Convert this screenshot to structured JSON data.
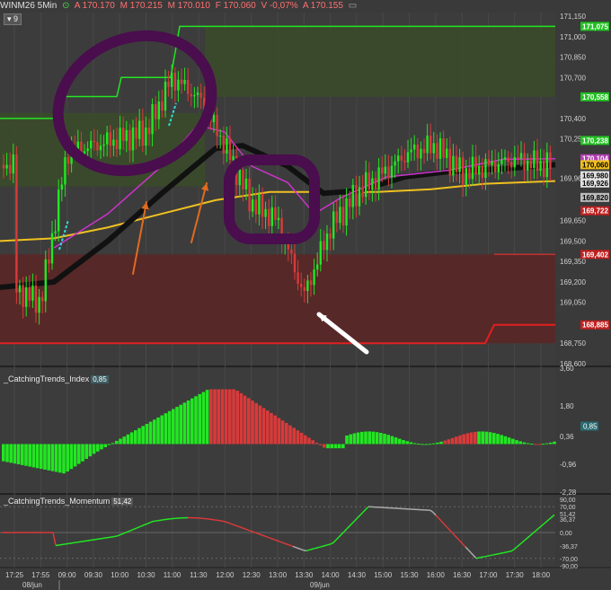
{
  "header": {
    "symbol": "WINM26 5Min",
    "open": "A 170.170",
    "high": "M 170.215",
    "low": "M 170.010",
    "close": "F 170.060",
    "change": "V -0,07%",
    "avg": "A 170.155",
    "layer_count": "9"
  },
  "colors": {
    "bg": "#3a3a3a",
    "up": "#22e622",
    "down": "#d83a3a",
    "annot_purple": "#4a0d4d",
    "orange_arrow": "#e06b20",
    "cyan": "#33dddd",
    "yellow": "#f0c020"
  },
  "main_chart": {
    "y_ticks": [
      "171,150",
      "171,000",
      "170,850",
      "170,700",
      "170,400",
      "170,250",
      "169,960",
      "169,650",
      "169,500",
      "169,350",
      "169,200",
      "169,050",
      "168,750",
      "168,600"
    ],
    "price_labels": [
      {
        "text": "171,075",
        "color": "#22c022"
      },
      {
        "text": "170,558",
        "color": "#22c022"
      },
      {
        "text": "170,238",
        "color": "#22c022"
      },
      {
        "text": "170,104",
        "color": "#b040b0"
      },
      {
        "text": "170,060",
        "color": "#f0c020"
      },
      {
        "text": "169,980",
        "color": "#222222"
      },
      {
        "text": "169,926",
        "color": "#222222"
      },
      {
        "text": "169,820",
        "color": "#333333"
      },
      {
        "text": "169,722",
        "color": "#c02020"
      },
      {
        "text": "169,402",
        "color": "#c02020"
      },
      {
        "text": "168,885",
        "color": "#c02020"
      }
    ]
  },
  "index_panel": {
    "label": "_CatchingTrends_Index",
    "value": "0,85",
    "y_ticks": [
      "3,60",
      "1,80",
      "0,36",
      "-0,96",
      "-2,28"
    ]
  },
  "momentum_panel": {
    "label": "_CatchingTrends_Momentum",
    "value": "51,42",
    "y_ticks": [
      "90,00",
      "70,00",
      "51,42",
      "36,37",
      "0,00",
      "-36,37",
      "-70,00",
      "-90,00"
    ]
  },
  "x_axis": {
    "ticks": [
      "17:25",
      "17:55",
      "09:00",
      "09:30",
      "10:00",
      "10:30",
      "11:00",
      "11:30",
      "12:00",
      "12:30",
      "13:00",
      "13:30",
      "14:00",
      "14:30",
      "15:00",
      "15:30",
      "16:00",
      "16:30",
      "17:00",
      "17:30",
      "18:00"
    ],
    "dates": [
      "08/jun",
      "09/jun"
    ]
  },
  "chart_data": {
    "type": "candlestick",
    "title": "WINM26 5Min",
    "y_range": [
      168600,
      171150
    ],
    "approx_path": {
      "x": [
        "17:25",
        "17:55",
        "09:00",
        "09:30",
        "10:00",
        "10:30",
        "11:00",
        "11:30",
        "12:00",
        "12:30",
        "13:00",
        "13:30",
        "14:00",
        "14:30",
        "15:00",
        "15:30",
        "16:00",
        "16:30",
        "17:00",
        "17:30",
        "18:00"
      ],
      "close": [
        169150,
        169050,
        170150,
        170200,
        170250,
        170300,
        170700,
        170550,
        170200,
        169780,
        169650,
        169100,
        169600,
        169850,
        170000,
        170150,
        170200,
        170000,
        170050,
        170100,
        170060
      ]
    },
    "indicators": {
      "catching_trends_index": {
        "range": [
          -2.28,
          3.6
        ],
        "last": 0.85
      },
      "catching_trends_momentum": {
        "range": [
          -90,
          90
        ],
        "last": 51.42
      }
    }
  }
}
